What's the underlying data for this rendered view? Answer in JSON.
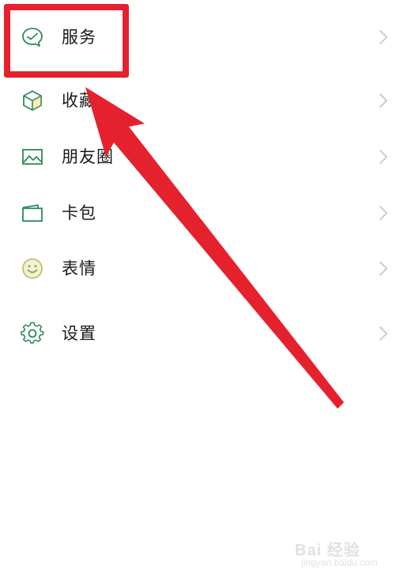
{
  "menu": {
    "items": [
      {
        "label": "服务",
        "icon": "service-icon"
      },
      {
        "label": "收藏",
        "icon": "favorites-cube-icon"
      },
      {
        "label": "朋友圈",
        "icon": "moments-image-icon"
      },
      {
        "label": "卡包",
        "icon": "card-wallet-icon"
      },
      {
        "label": "表情",
        "icon": "emoji-smile-icon"
      },
      {
        "label": "设置",
        "icon": "gear-icon"
      }
    ],
    "chevron_icon": "chevron-right-icon"
  },
  "annotation": {
    "color": "#e5212e",
    "highlight_target": "服务"
  },
  "watermark": {
    "text": "Bai 经验",
    "sub": "jingyan.baidu.com"
  },
  "colors": {
    "icon_green": "#2e8b57",
    "text": "#1a1a1a",
    "chevron": "#c7c7c7"
  }
}
